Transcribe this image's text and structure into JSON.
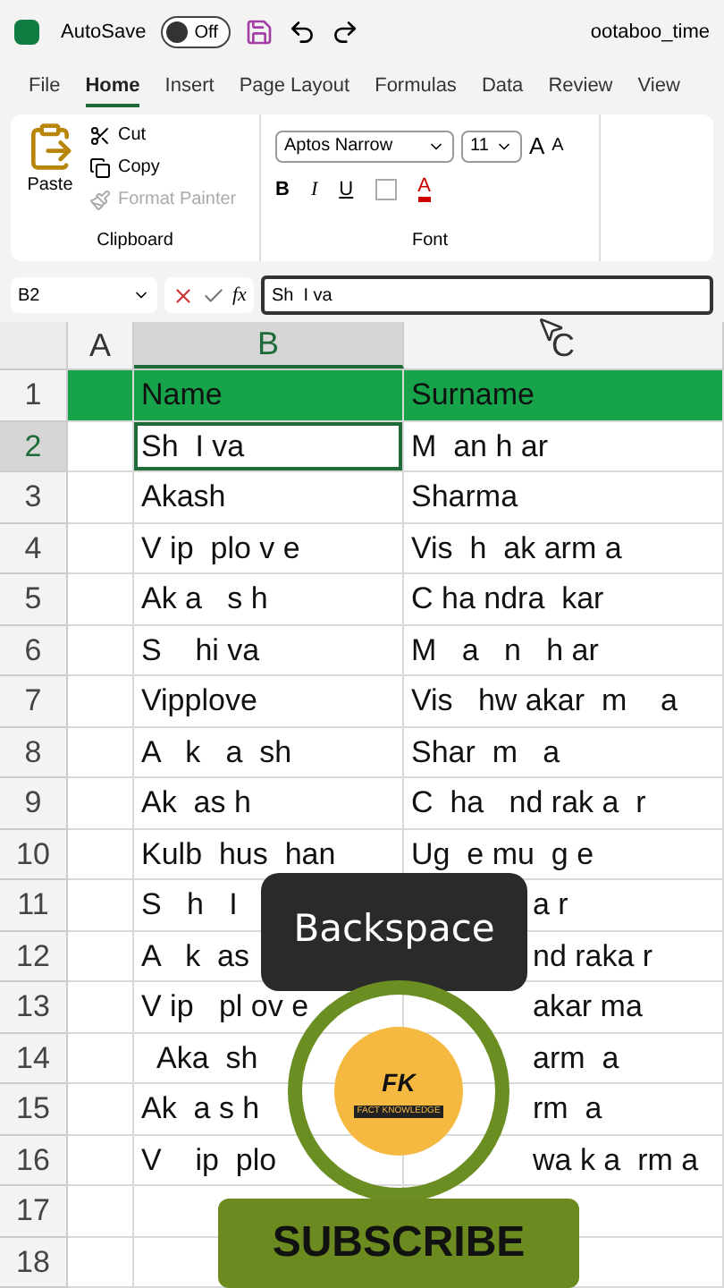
{
  "title_bar": {
    "autosave_label": "AutoSave",
    "autosave_toggle": {
      "label": "Off",
      "on": false
    },
    "filename": "ootaboo_time"
  },
  "menu_tabs": [
    {
      "label": "File",
      "selected": false
    },
    {
      "label": "Home",
      "selected": true
    },
    {
      "label": "Insert",
      "selected": false
    },
    {
      "label": "Page Layout",
      "selected": false
    },
    {
      "label": "Formulas",
      "selected": false
    },
    {
      "label": "Data",
      "selected": false
    },
    {
      "label": "Review",
      "selected": false
    },
    {
      "label": "View",
      "selected": false
    }
  ],
  "ribbon": {
    "clipboard": {
      "paste": "Paste",
      "cut": "Cut",
      "copy": "Copy",
      "format_painter": {
        "label": "Format Painter",
        "disabled": true
      },
      "group_label": "Clipboard"
    },
    "font": {
      "font_name": "Aptos Narrow",
      "font_size": "11",
      "bold": "B",
      "italic": "I",
      "underline": "U",
      "grow": "A",
      "shrink": "A",
      "font_color": "A",
      "group_label": "Font"
    }
  },
  "formula_bar": {
    "name_box": "B2",
    "function_label": "fx",
    "value": "Sh  I va"
  },
  "sheet": {
    "columns": [
      {
        "label": "A",
        "selected": false
      },
      {
        "label": "B",
        "selected": true
      },
      {
        "label": "C",
        "selected": false
      }
    ],
    "rows": [
      {
        "number": "1",
        "selected": false,
        "kind": "header",
        "b": "Name",
        "c": "Surname"
      },
      {
        "number": "2",
        "selected": true,
        "kind": "data",
        "b": "Sh  I va",
        "c": "M  an h ar",
        "b_selected": true
      },
      {
        "number": "3",
        "selected": false,
        "kind": "data",
        "b": "Akash",
        "c": "Sharma"
      },
      {
        "number": "4",
        "selected": false,
        "kind": "data",
        "b": "V ip  plo v e",
        "c": "Vis  h  ak arm a"
      },
      {
        "number": "5",
        "selected": false,
        "kind": "data",
        "b": "Ak a   s h",
        "c": "C ha ndra  kar"
      },
      {
        "number": "6",
        "selected": false,
        "kind": "data",
        "b": "S    hi va",
        "c": "M   a   n   h ar"
      },
      {
        "number": "7",
        "selected": false,
        "kind": "data",
        "b": "Vipplove",
        "c": "Vis   hw akar  m    a"
      },
      {
        "number": "8",
        "selected": false,
        "kind": "data",
        "b": "A   k   a  sh",
        "c": "Shar  m   a"
      },
      {
        "number": "9",
        "selected": false,
        "kind": "data",
        "b": "Ak  as h",
        "c": "C  ha   nd rak a  r"
      },
      {
        "number": "10",
        "selected": false,
        "kind": "data",
        "b": "Kulb  hus  han",
        "c": "Ug  e mu  g e"
      },
      {
        "number": "11",
        "selected": false,
        "kind": "data",
        "b": "S   h   I",
        "c": "a r",
        "c_partly_hidden": true
      },
      {
        "number": "12",
        "selected": false,
        "kind": "data",
        "b": "A   k  as",
        "c": "nd raka r",
        "c_partly_hidden": true
      },
      {
        "number": "13",
        "selected": false,
        "kind": "data",
        "b": "V ip   pl ov e",
        "c": "akar ma",
        "c_partly_hidden": true
      },
      {
        "number": "14",
        "selected": false,
        "kind": "data",
        "b": "  Aka  sh",
        "c": "arm  a",
        "c_partly_hidden": true
      },
      {
        "number": "15",
        "selected": false,
        "kind": "data",
        "b": "Ak  a s h",
        "c": "rm  a",
        "c_partly_hidden": true
      },
      {
        "number": "16",
        "selected": false,
        "kind": "data",
        "b": "V    ip  plo",
        "c": "wa k a  rm a",
        "c_partly_hidden": true
      },
      {
        "number": "17",
        "selected": false,
        "kind": "empty"
      },
      {
        "number": "18",
        "selected": false,
        "kind": "empty"
      }
    ]
  },
  "overlay": {
    "key_label": "Backspace",
    "logo": {
      "initials": "FK",
      "caption": "FACT KNOWLEDGE"
    },
    "subscribe": "SUBSCRIBE"
  }
}
